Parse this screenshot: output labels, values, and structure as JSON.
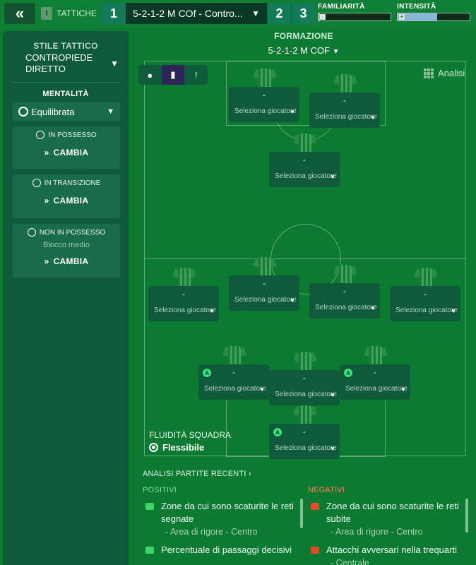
{
  "topbar": {
    "back_icon": "double-chevron-left-icon",
    "tactics_label": "TATTICHE",
    "slot_active": "1",
    "tactic_name": "5-2-1-2 M COf - Contro...",
    "slot_2": "2",
    "slot_3": "3",
    "familiarity_label": "FAMILIARITÀ",
    "familiarity_fraction": 0.02,
    "intensity_label": "INTENSITÀ",
    "intensity_fraction": 0.55
  },
  "left": {
    "style_title": "STILE TATTICO",
    "style_line1": "CONTROPIEDE",
    "style_line2": "DIRETTO",
    "mentality_title": "MENTALITÀ",
    "mentality_value": "Equilibrata",
    "phases": [
      {
        "title": "IN POSSESSO",
        "sub": "",
        "action": "CAMBIA"
      },
      {
        "title": "IN TRANSIZIONE",
        "sub": "",
        "action": "CAMBIA"
      },
      {
        "title": "NON IN POSSESSO",
        "sub": "Blocco medio",
        "action": "CAMBIA"
      }
    ]
  },
  "formation": {
    "title": "FORMAZIONE",
    "value": "5-2-1-2 M COF"
  },
  "view": {
    "analysis_label": "Analisi"
  },
  "players": [
    {
      "name": "-",
      "select": "Seleziona giocatore",
      "role_badge": ""
    },
    {
      "name": "-",
      "select": "Seleziona giocatore",
      "role_badge": ""
    },
    {
      "name": "-",
      "select": "Seleziona giocatore",
      "role_badge": ""
    },
    {
      "name": "-",
      "select": "Seleziona giocatore",
      "role_badge": ""
    },
    {
      "name": "-",
      "select": "Seleziona giocatore",
      "role_badge": ""
    },
    {
      "name": "-",
      "select": "Seleziona giocatore",
      "role_badge": ""
    },
    {
      "name": "-",
      "select": "Seleziona giocatore",
      "role_badge": ""
    },
    {
      "name": "-",
      "select": "Seleziona giocatore",
      "role_badge": "A"
    },
    {
      "name": "-",
      "select": "Seleziona giocatore",
      "role_badge": ""
    },
    {
      "name": "-",
      "select": "Seleziona giocatore",
      "role_badge": "A"
    },
    {
      "name": "-",
      "select": "Seleziona giocatore",
      "role_badge": "A"
    }
  ],
  "fluidity": {
    "label": "FLUIDITÀ SQUADRA",
    "value": "Flessibile"
  },
  "recent": {
    "title": "ANALISI PARTITE RECENTI",
    "positives_title": "POSITIVI",
    "negatives_title": "NEGATIVI",
    "positives": [
      {
        "text": "Zone da cui sono scaturite le reti segnate",
        "sub": "- Area di rigore - Centro"
      },
      {
        "text": "Percentuale di passaggi decisivi",
        "sub": ""
      }
    ],
    "negatives": [
      {
        "text": "Zone da cui sono scaturite le reti subite",
        "sub": "- Area di rigore - Centro"
      },
      {
        "text": "Attacchi avversari nella trequarti",
        "sub": "- Centrale"
      }
    ]
  }
}
